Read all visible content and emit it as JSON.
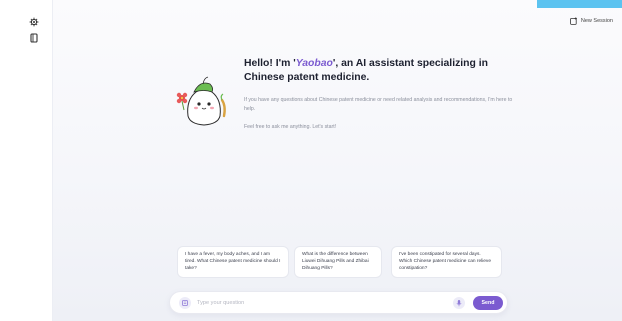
{
  "sidebar": {
    "icons": [
      {
        "name": "settings-icon"
      },
      {
        "name": "book-icon"
      }
    ]
  },
  "header": {
    "new_session_label": "New Session"
  },
  "welcome": {
    "greeting_prefix": "Hello! I'm '",
    "assistant_name": "Yaobao",
    "greeting_suffix": "', an AI assistant specializing in Chinese patent medicine.",
    "intro": "If you have any questions about Chinese patent medicine or need related analysis and recommendations, I'm here to help.",
    "invite": "Feel free to ask me anything. Let's start!"
  },
  "suggestions": [
    "I have a fever, my body aches, and I am tired. What Chinese patent medicine should I take?",
    "What is the difference between Liuwei Dihuang Pills and Zhibai Dihuang Pills?",
    "I've been constipated for several days. Which Chinese patent medicine can relieve constipation?"
  ],
  "composer": {
    "placeholder": "Type your question",
    "send_label": "Send"
  },
  "colors": {
    "accent": "#7b5bd0",
    "corner": "#5cc3f0"
  }
}
